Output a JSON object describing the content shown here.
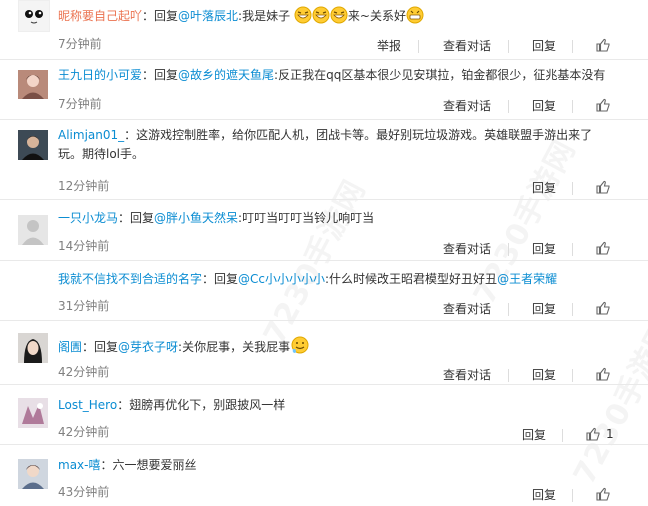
{
  "comments": [
    {
      "user": "昵称要自己起吖",
      "text_a": "：回复",
      "mention": "@叶落辰北",
      "text_b": ":我是妹子",
      "text_c": "来~关系好",
      "time": "7分钟前",
      "report": "举报",
      "view": "查看对话",
      "reply": "回复",
      "likes": ""
    },
    {
      "user": "王九日的小可爱",
      "text_a": "：回复",
      "mention": "@故乡的遮天鱼尾",
      "text_b": ":反正我在qq区基本很少见安琪拉，铂金都很少，征兆基本没有",
      "time": "7分钟前",
      "view": "查看对话",
      "reply": "回复"
    },
    {
      "user": "Alimjan01_",
      "text": "：这游戏控制胜率，给你匹配人机，团战卡等。最好别玩垃圾游戏。英雄联盟手游出来了玩。期待lol手。",
      "time": "12分钟前",
      "reply": "回复"
    },
    {
      "user": "一只小龙马",
      "text_a": "：回复",
      "mention": "@胖小鱼天然呆",
      "text_b": ":叮叮当叮叮当铃儿响叮当",
      "time": "14分钟前",
      "view": "查看对话",
      "reply": "回复"
    },
    {
      "user": "我就不信找不到合适的名字",
      "text_a": "：回复",
      "mention": "@Cc小小小小小",
      "text_b": ":什么时候改王昭君模型好丑好丑",
      "mention2": "@王者荣耀",
      "time": "31分钟前",
      "view": "查看对话",
      "reply": "回复"
    },
    {
      "user": "阁圊",
      "text_a": "：回复",
      "mention": "@芽衣子呀",
      "text_b": ":关你屁事，关我屁事",
      "time": "42分钟前",
      "view": "查看对话",
      "reply": "回复"
    },
    {
      "user": "Lost_Hero",
      "text": "：翅膀再优化下，别跟披风一样",
      "time": "42分钟前",
      "reply": "回复",
      "likes": "1"
    },
    {
      "user": "max-嘻",
      "text": "：六一想要爱丽丝",
      "time": "43分钟前",
      "reply": "回复"
    }
  ],
  "watermark": "7230手游网",
  "colors": {
    "username": "#eb7350",
    "mention": "#0a8cd2",
    "time": "#808080"
  }
}
